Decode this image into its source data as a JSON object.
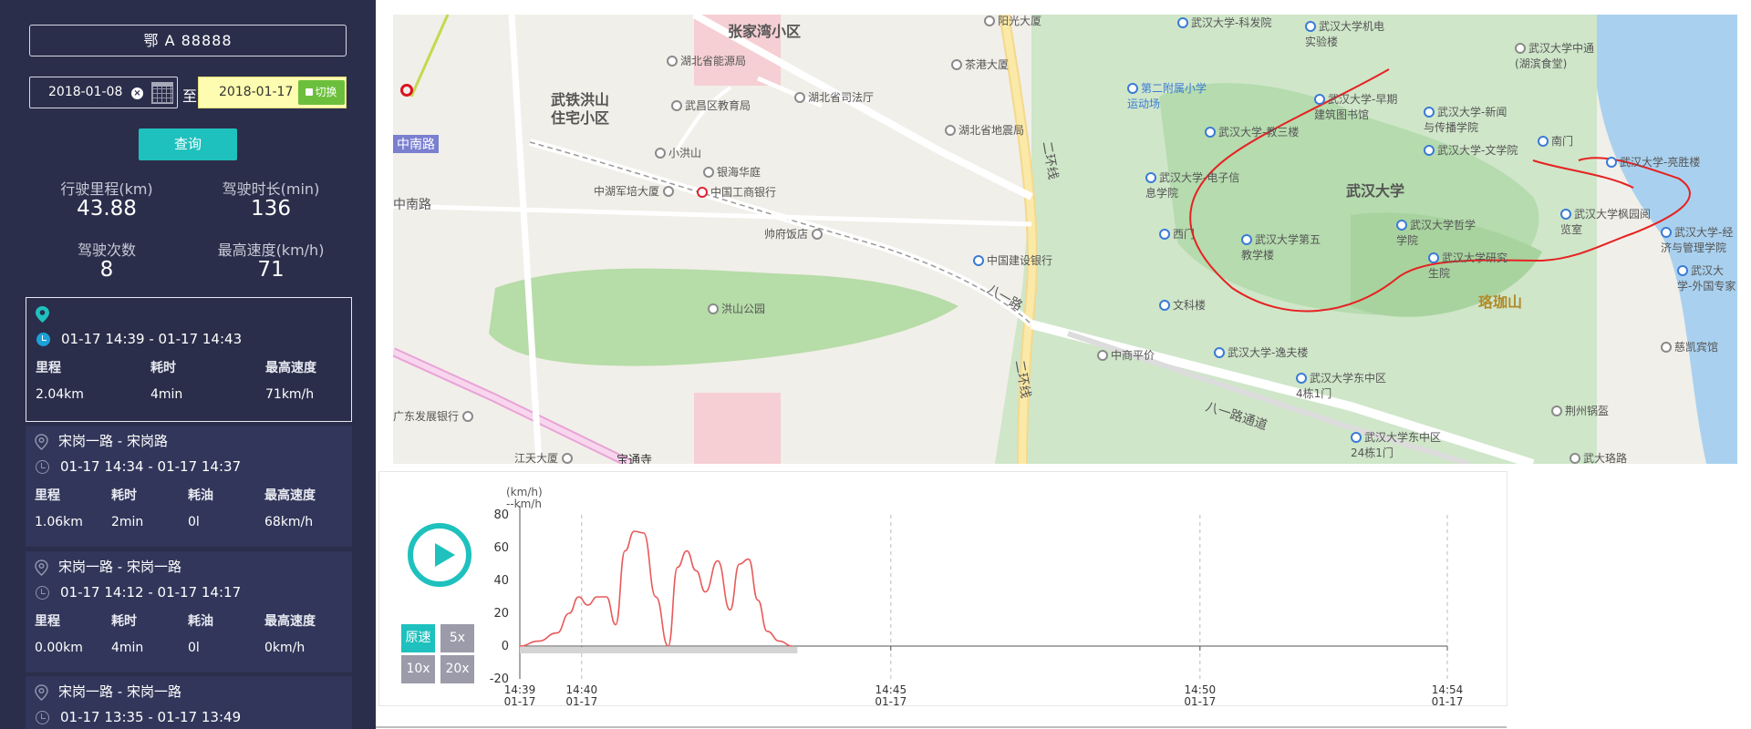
{
  "sidebar": {
    "plate": "鄂 A 88888",
    "start_date": "2018-01-08",
    "to_label": "至",
    "end_date": "2018-01-17",
    "switch_label": "切换",
    "query_label": "查询",
    "stats": {
      "mileage_label": "行驶里程(km)",
      "mileage_value": "43.88",
      "duration_label": "驾驶时长(min)",
      "duration_value": "136",
      "count_label": "驾驶次数",
      "count_value": "8",
      "maxspeed_label": "最高速度(km/h)",
      "maxspeed_value": "71"
    },
    "trips": [
      {
        "title": "",
        "time": "01-17 14:39 - 01-17 14:43",
        "headers": [
          "里程",
          "耗时",
          "最高速度"
        ],
        "values": [
          "2.04km",
          "4min",
          "71km/h"
        ]
      },
      {
        "title": "宋岗一路 - 宋岗路",
        "time": "01-17 14:34 - 01-17 14:37",
        "headers": [
          "里程",
          "耗时",
          "耗油",
          "最高速度"
        ],
        "values": [
          "1.06km",
          "2min",
          "0l",
          "68km/h"
        ]
      },
      {
        "title": "宋岗一路 - 宋岗一路",
        "time": "01-17 14:12 - 01-17 14:17",
        "headers": [
          "里程",
          "耗时",
          "耗油",
          "最高速度"
        ],
        "values": [
          "0.00km",
          "4min",
          "0l",
          "0km/h"
        ]
      },
      {
        "title": "宋岗一路 - 宋岗一路",
        "time": "01-17 13:35 - 01-17 13:49"
      }
    ]
  },
  "map": {
    "labels": {
      "zhangjiawan": "张家湾小区",
      "yangguang": "阳光大厦",
      "hbnyy": "湖北省能源局",
      "wutie": "武铁洪山",
      "zhuzhai": "住宅小区",
      "wuchang_edu": "武昌区教育局",
      "hb_sifa": "湖北省司法厅",
      "chagang": "茶港大厦",
      "xiaohongshan": "小洪山",
      "yinhai": "银海华庭",
      "hb_dizhen": "湖北省地震局",
      "zhonghu": "中湖军培大厦",
      "icbc": "中国工商银行",
      "shuaifu": "帅府饭店",
      "ccb": "中国建设银行",
      "hongshan_park": "洪山公园",
      "nanlu1": "中南路",
      "nanlu2": "中南路",
      "guangfa": "广东发展银行",
      "jiangtian": "江天大厦",
      "baotong": "宝通寺",
      "erhuan1": "二环线",
      "erhuan2": "二环线",
      "bayilu": "八一路",
      "bayilu_tunnel": "八一路通道",
      "zhongshang": "中商平价",
      "whu": "武汉大学",
      "luojiashan": "珞珈山",
      "whu_kefa": "武汉大学-科发院",
      "whu_jidian": "武汉大学机电实验楼",
      "whu_zaoqi": "武汉大学-早期建筑图书馆",
      "whu_xinwen": "武汉大学-新闻与传播学院",
      "whu_wenxue": "武汉大学-文学院",
      "whu_jiaosan": "武汉大学-教三楼",
      "whu_dianzi": "武汉大学-电子信息学院",
      "whu_zhongtong": "武汉大学中通(湖滨食堂)",
      "whu_liangsheng": "武汉大学-亮胜楼",
      "nanmen": "南门",
      "ximen": "西门",
      "whu_diwu": "武汉大学第五教学楼",
      "whu_zhexue": "武汉大学哲学学院",
      "whu_yanjiusheng": "武汉大学研究生院",
      "whu_fengyuan": "武汉大学枫园阅览室",
      "whu_guanli": "武汉大学-经济与管理学院",
      "whu_waiguo": "武汉大学-外国专家",
      "wenke": "文科楼",
      "whu_yifu": "武汉大学-逸夫楼",
      "whu_dongzhong1": "武汉大学东中区4栋1门",
      "whu_dongzhong2": "武汉大学东中区24栋1门",
      "cikai": "慈凯宾馆",
      "jingchu": "荆州锅盔",
      "wuda_luojia": "武大珞路",
      "dier_fushu": "第二附属小学运动场"
    }
  },
  "player": {
    "speeds": [
      "原速",
      "5x",
      "10x",
      "20x"
    ],
    "active_speed": "原速"
  },
  "chart_data": {
    "type": "line",
    "title": "",
    "ylabel": "(km/h)",
    "y_unit_label": "--km/h",
    "xlabel": "",
    "ylim": [
      -20,
      80
    ],
    "yticks": [
      "80",
      "60",
      "40",
      "20",
      "0",
      "-20"
    ],
    "xlim": [
      "14:39",
      "14:54"
    ],
    "xticks": [
      {
        "time": "14:39",
        "date": "01-17"
      },
      {
        "time": "14:40",
        "date": "01-17"
      },
      {
        "time": "14:45",
        "date": "01-17"
      },
      {
        "time": "14:50",
        "date": "01-17"
      },
      {
        "time": "14:54",
        "date": "01-17"
      }
    ],
    "grid": "vertical-dashed",
    "series": [
      {
        "color": "#e85a5a",
        "x_minutes": [
          0,
          0.3,
          0.6,
          0.8,
          0.95,
          1.1,
          1.25,
          1.4,
          1.55,
          1.7,
          1.85,
          2.0,
          2.2,
          2.4,
          2.55,
          2.7,
          2.85,
          3.0,
          3.2,
          3.4,
          3.55,
          3.7,
          3.85,
          4.0,
          4.2,
          4.4
        ],
        "values": [
          0,
          3,
          8,
          20,
          30,
          25,
          30,
          30,
          13,
          58,
          70,
          69,
          30,
          0,
          48,
          58,
          46,
          33,
          52,
          22,
          50,
          53,
          28,
          9,
          3,
          0
        ]
      }
    ]
  }
}
